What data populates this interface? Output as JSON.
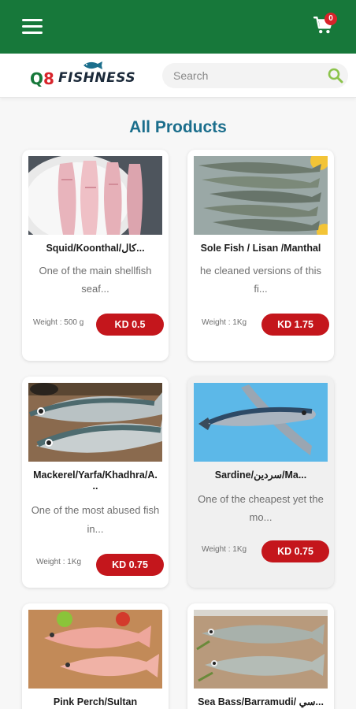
{
  "topbar": {
    "menu_icon": "hamburger-menu-icon",
    "cart_icon": "shopping-cart-icon",
    "cart_count": "0",
    "background": "#17783a"
  },
  "header": {
    "logo_q": "Q",
    "logo_8": "8",
    "logo_text": "FISHNESS",
    "search_placeholder": "Search",
    "search_icon": "search-icon",
    "accent": "#8bc34a"
  },
  "main": {
    "title": "All Products",
    "price_color": "#c4161c",
    "products": [
      {
        "name": "Squid/Koonthal/كال...",
        "desc_line1": "One of the main shellfish",
        "desc_line2": "seaf...",
        "weight": "Weight : 500 g",
        "price": "KD 0.5",
        "image": "squid"
      },
      {
        "name": "Sole Fish / Lisan /Manthal",
        "desc_line1": "he cleaned versions of this",
        "desc_line2": "fi...",
        "weight": "Weight : 1Kg",
        "price": "KD 1.75",
        "image": "sole-fish"
      },
      {
        "name": "Mackerel/Yarfa/Khadhra/A.",
        "name2": "..",
        "desc_line1": "One of the most abused fish",
        "desc_line2": "in...",
        "weight": "Weight : 1Kg",
        "price": "KD 0.75",
        "image": "mackerel"
      },
      {
        "name": "Sardine/سردين/Ma...",
        "desc_line1": "One of the cheapest yet the",
        "desc_line2": "mo...",
        "weight": "Weight : 1Kg",
        "price": "KD 0.75",
        "image": "sardine"
      },
      {
        "name": "Pink Perch/Sultan",
        "image": "pink-perch"
      },
      {
        "name": "Sea Bass/Barramudi/ سي...",
        "image": "sea-bass"
      }
    ]
  }
}
